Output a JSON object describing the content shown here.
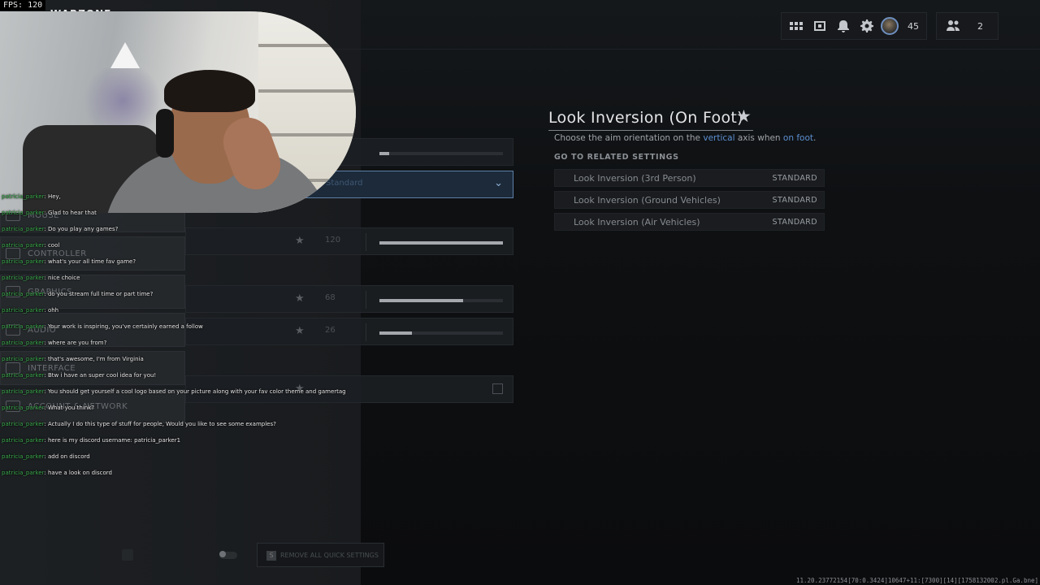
{
  "fps": "FPS: 120",
  "app": {
    "logo": "WARZONE"
  },
  "tray": {
    "level": "45",
    "party_count": "2"
  },
  "categories": [
    {
      "label": "MOUSE"
    },
    {
      "label": "CONTROLLER"
    },
    {
      "label": "GRAPHICS"
    },
    {
      "label": "AUDIO"
    },
    {
      "label": "INTERFACE"
    },
    {
      "label": "ACCOUNT & NETWORK"
    }
  ],
  "settings_rows": {
    "dropdown_value": "Standard",
    "slider1": {
      "value": "120",
      "fraction": 1.0
    },
    "slider2": {
      "value": "68",
      "fraction": 0.68
    },
    "slider3": {
      "value": "26",
      "fraction": 0.26
    }
  },
  "detail": {
    "title": "Look Inversion (On Foot)",
    "desc_prefix": "Choose the aim orientation on the ",
    "desc_hl1": "vertical",
    "desc_mid": " axis when ",
    "desc_hl2": "on foot",
    "desc_suffix": ".",
    "related_header": "GO TO RELATED SETTINGS",
    "related": [
      {
        "label": "Look Inversion (3rd Person)",
        "value": "STANDARD"
      },
      {
        "label": "Look Inversion (Ground Vehicles)",
        "value": "STANDARD"
      },
      {
        "label": "Look Inversion (Air Vehicles)",
        "value": "STANDARD"
      }
    ]
  },
  "chat": [
    {
      "user": "patricia_parker",
      "msg": ": Hey,"
    },
    {
      "user": "patricia_parker",
      "msg": ": Glad to hear that"
    },
    {
      "user": "patricia_parker",
      "msg": ": Do you play any games?"
    },
    {
      "user": "patricia_parker",
      "msg": ": cool"
    },
    {
      "user": "patricia_parker",
      "msg": ": what's your all time fav game?"
    },
    {
      "user": "patricia_parker",
      "msg": ": nice choice"
    },
    {
      "user": "patricia_parker",
      "msg": ": do you stream full time or part time?"
    },
    {
      "user": "patricia_parker",
      "msg": ": ohh"
    },
    {
      "user": "patricia_parker",
      "msg": ": Your work is inspiring, you've certainly earned a follow"
    },
    {
      "user": "patricia_parker",
      "msg": ": where are you from?"
    },
    {
      "user": "patricia_parker",
      "msg": ": that's awesome, I'm from Virginia"
    },
    {
      "user": "patricia_parker",
      "msg": ": Btw i have an super cool idea for you!"
    },
    {
      "user": "patricia_parker",
      "msg": ": You should get yourself a cool logo based on your picture along with your fav color theme and gamertag"
    },
    {
      "user": "patricia_parker",
      "msg": ": What you think?"
    },
    {
      "user": "patricia_parker",
      "msg": ": Actually I do this type of stuff for people, Would you like to see some examples?"
    },
    {
      "user": "patricia_parker",
      "msg": ": here is my discord username: patricia_parker1"
    },
    {
      "user": "patricia_parker",
      "msg": ": add on discord"
    },
    {
      "user": "patricia_parker",
      "msg": ": have a look on discord"
    }
  ],
  "bottom": {
    "remove_label": "REMOVE ALL QUICK SETTINGS",
    "remove_key": "S"
  },
  "build": "11.20.23772154[70:0.3424]10647+11:[7300][14][1758132002.pl.Ga.bne]"
}
